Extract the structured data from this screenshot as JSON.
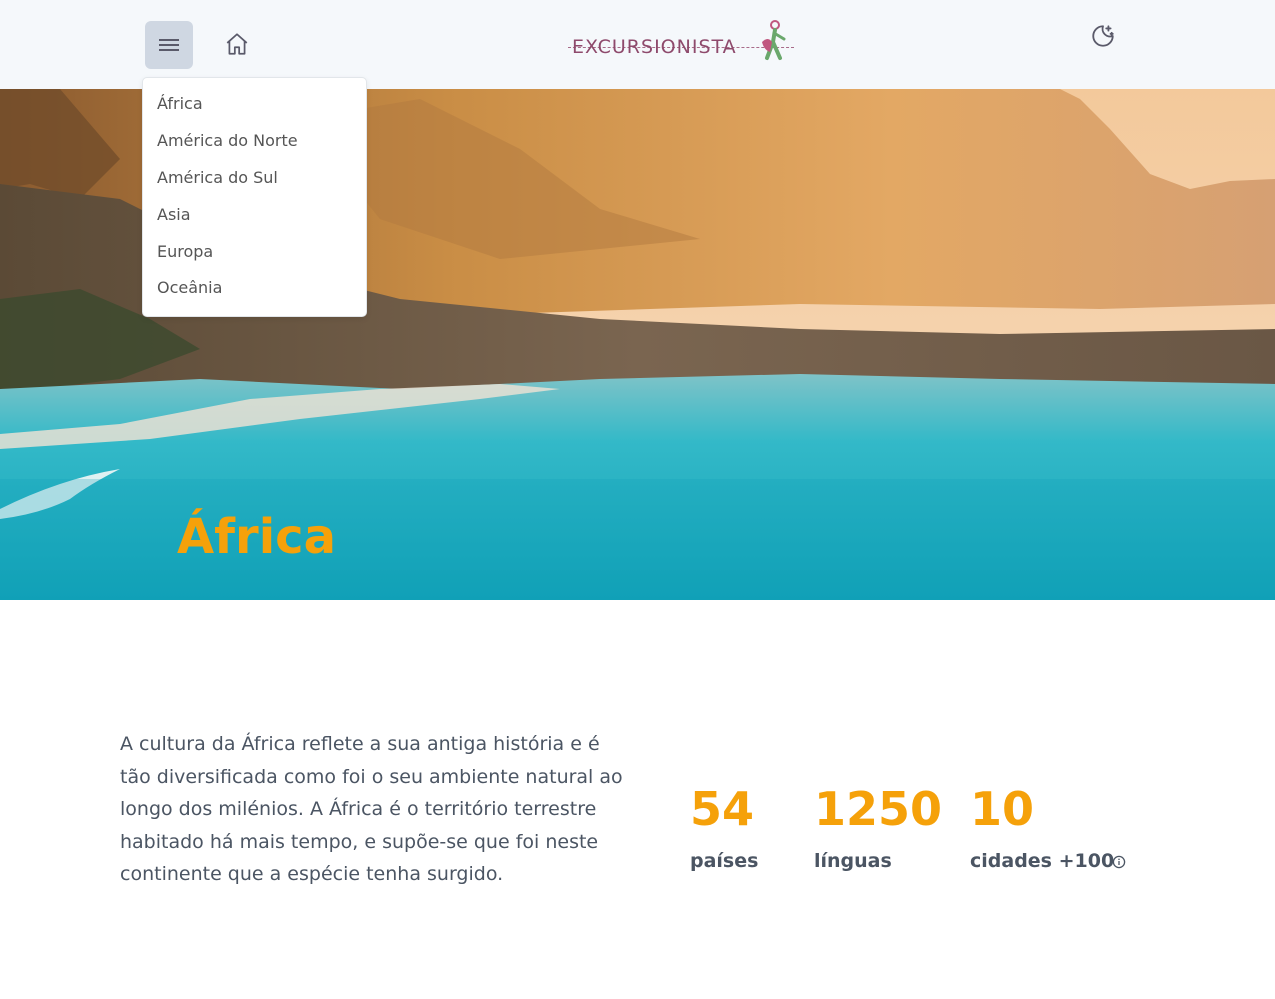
{
  "header": {
    "logo_text": "EXCURSIONISTA",
    "menu_icon": "hamburger-icon",
    "home_icon": "home-icon",
    "theme_icon": "moon-star-icon"
  },
  "dropdown": {
    "items": [
      "África",
      "América do Norte",
      "América do Sul",
      "Asia",
      "Europa",
      "Oceânia"
    ]
  },
  "hero": {
    "title": "África"
  },
  "content": {
    "description": "A cultura da África reflete a sua antiga história e é tão diversificada como foi o seu ambiente natural ao longo dos milénios. A África é o território terrestre habitado há mais tempo, e supõe-se que foi neste continente que a espécie tenha surgido.",
    "stats": [
      {
        "value": "54",
        "label": "países"
      },
      {
        "value": "1250",
        "label": "línguas"
      },
      {
        "value": "10",
        "label": "cidades +100"
      }
    ],
    "info_icon": "info-icon"
  },
  "colors": {
    "accent": "#f5a10a",
    "header_bg": "#f5f8fb",
    "text": "#4b5563",
    "logo": "#8e4a6c"
  }
}
